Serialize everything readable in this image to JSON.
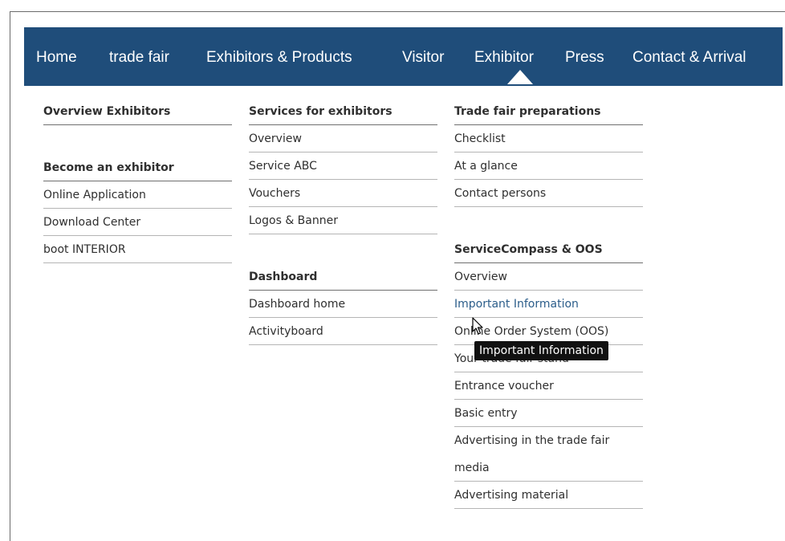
{
  "nav": {
    "items": [
      "Home",
      "trade fair",
      "Exhibitors & Products",
      "Visitor",
      "Exhibitor",
      "Press",
      "Contact & Arrival"
    ],
    "active": "Exhibitor"
  },
  "col1": {
    "heading1": "Overview Exhibitors",
    "heading2": "Become an exhibitor",
    "items": [
      "Online Application",
      "Download Center",
      "boot INTERIOR"
    ]
  },
  "col2": {
    "heading1": "Services for exhibitors",
    "items1": [
      "Overview",
      "Service ABC",
      "Vouchers",
      "Logos & Banner"
    ],
    "heading2": "Dashboard",
    "items2": [
      "Dashboard home",
      "Activityboard"
    ]
  },
  "col3": {
    "heading1": "Trade fair preparations",
    "items1": [
      "Checklist",
      "At a glance",
      "Contact persons"
    ],
    "heading2": "ServiceCompass & OOS",
    "items2": [
      "Overview",
      "Important Information",
      "Online Order System (OOS)",
      "Your trade fair stand",
      "Entrance voucher",
      "Basic entry",
      "Advertising in the trade fair",
      "media",
      "Advertising material"
    ]
  },
  "tooltip": "Important Information",
  "colors": {
    "navbar": "#1f4d7a",
    "text": "#2f2f2f",
    "hover": "#2b5d8a"
  }
}
